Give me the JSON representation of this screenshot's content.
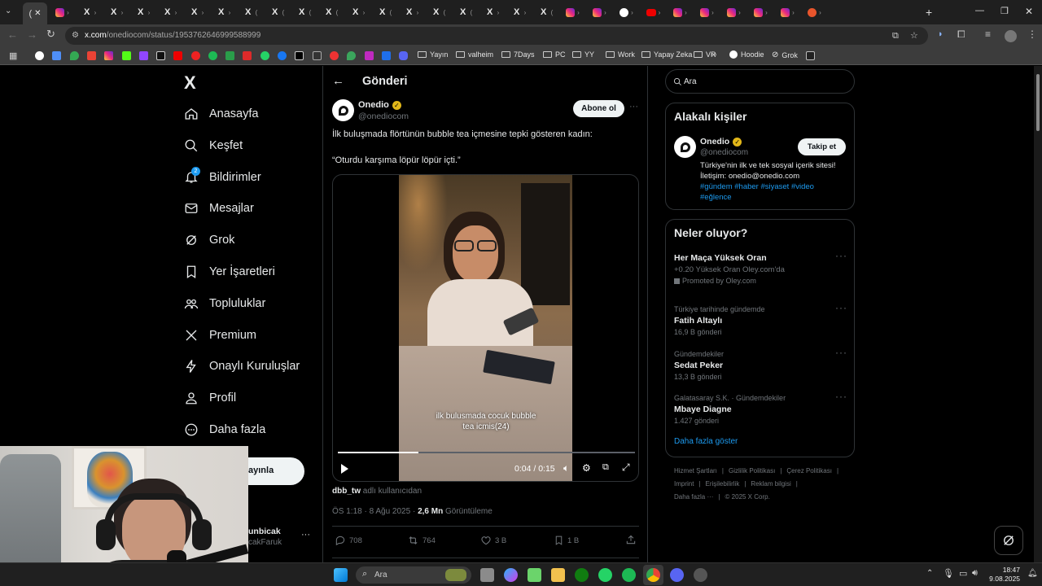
{
  "browser": {
    "url_host": "x.com",
    "url_path": "/onediocom/status/1953762646999588999",
    "tab_glyph": "X",
    "tab_paren": "(",
    "close_glyph": "✕",
    "new_tab": "+",
    "bookmarks": [
      {
        "label": "Yayın"
      },
      {
        "label": "valheim"
      },
      {
        "label": "7Days"
      },
      {
        "label": "PC"
      },
      {
        "label": "YY"
      },
      {
        "label": "Work"
      },
      {
        "label": "Yapay Zeka"
      },
      {
        "label": "VR"
      },
      {
        "label": "Hoodie"
      },
      {
        "label": "Grok"
      }
    ]
  },
  "sidebar": {
    "logo": "X",
    "items": [
      {
        "label": "Anasayfa",
        "icon": "home-icon"
      },
      {
        "label": "Keşfet",
        "icon": "search-icon"
      },
      {
        "label": "Bildirimler",
        "icon": "bell-icon",
        "badge": "2"
      },
      {
        "label": "Mesajlar",
        "icon": "mail-icon"
      },
      {
        "label": "Grok",
        "icon": "grok-icon"
      },
      {
        "label": "Yer İşaretleri",
        "icon": "bookmark-icon"
      },
      {
        "label": "Topluluklar",
        "icon": "communities-icon"
      },
      {
        "label": "Premium",
        "icon": "x-premium-icon"
      },
      {
        "label": "Onaylı Kuruluşlar",
        "icon": "lightning-icon"
      },
      {
        "label": "Profil",
        "icon": "profile-icon"
      },
      {
        "label": "Daha fazla",
        "icon": "more-circle-icon"
      }
    ],
    "post_button": "ayınla",
    "account_name": "unbicak",
    "account_handle": "cakFaruk"
  },
  "post": {
    "header_title": "Gönderi",
    "author_name": "Onedio",
    "author_handle": "@onediocom",
    "subscribe_button": "Abone ol",
    "text_line1": "İlk buluşmada flörtünün bubble tea içmesine tepki gösteren kadın:",
    "text_line2": "“Oturdu karşıma löpür löpür içti.”",
    "video": {
      "subtitle_line1": "ilk bulusmada cocuk bubble",
      "subtitle_line2": "tea icmis(24)",
      "time": "0:04 / 0:15",
      "progress": 0.27
    },
    "source_user": "dbb_tw",
    "source_suffix": "adlı kullanıcıdan",
    "time": "ÖS 1:18 · 8 Ağu 2025 ·",
    "views_count": "2,6 Mn",
    "views_label": "Görüntüleme",
    "replies": "708",
    "reposts": "764",
    "likes": "3 B",
    "bookmarks": "1 B"
  },
  "right": {
    "search_placeholder": "Ara",
    "related_title": "Alakalı kişiler",
    "related_name": "Onedio",
    "related_handle": "@onediocom",
    "follow_button": "Takip et",
    "related_bio": "Türkiye'nin ilk ve tek sosyal içerik sitesi! İletişim: onedio@onedio.com",
    "related_tags": "#gündem #haber #siyaset #video",
    "related_tags2": "#eğlence",
    "trends_title": "Neler oluyor?",
    "trends": [
      {
        "context": "",
        "title": "Her Maça Yüksek Oran",
        "count": "+0.20 Yüksek Oran Oley.com'da",
        "promoted": "Promoted by Oley.com"
      },
      {
        "context": "Türkiye tarihinde gündemde",
        "title": "Fatih Altaylı",
        "count": "16,9 B gönderi"
      },
      {
        "context": "Gündemdekiler",
        "title": "Sedat Peker",
        "count": "13,3 B gönderi"
      },
      {
        "context": "Galatasaray S.K. · Gündemdekiler",
        "title": "Mbaye Diagne",
        "count": "1.427 gönderi"
      }
    ],
    "show_more": "Daha fazla göster",
    "footer": [
      "Hizmet Şartları",
      "Gizlilik Politikası",
      "Çerez Politikası",
      "Imprint",
      "Erişilebilirlik",
      "Reklam bilgisi",
      "Daha fazla ···",
      "© 2025 X Corp."
    ]
  },
  "taskbar": {
    "search_placeholder": "Ara",
    "clock_time": "18:47",
    "clock_date": "9.08.2025"
  },
  "colors": {
    "accent": "#1d9bf0",
    "verified": "#e2b719",
    "background": "#000000"
  }
}
